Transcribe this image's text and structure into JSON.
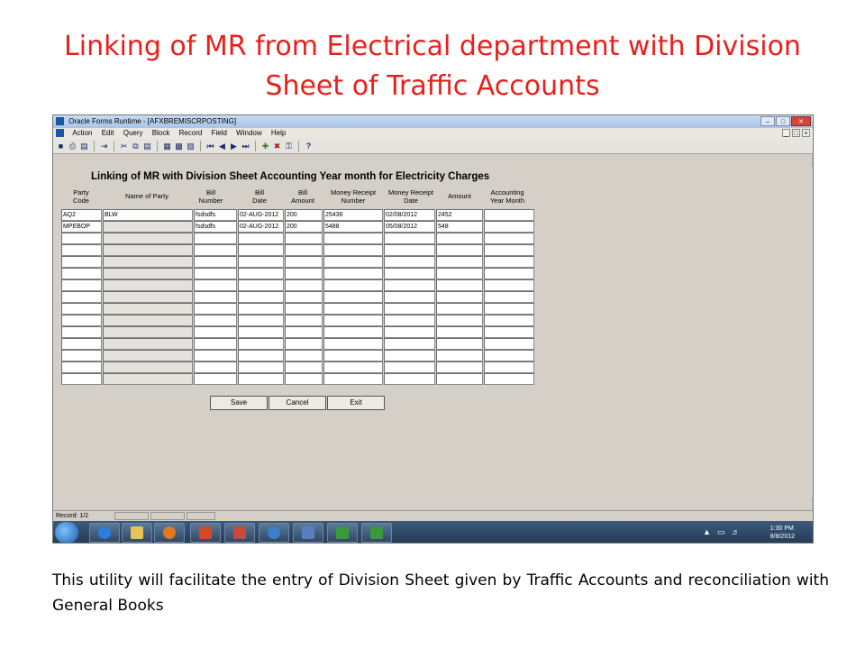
{
  "slide": {
    "title_line1": "Linking of MR from Electrical department with Division",
    "title_line2": "Sheet of Traffic Accounts",
    "caption": "This utility will facilitate the entry of Division Sheet given by Traffic Accounts and reconciliation with General Books"
  },
  "window": {
    "title": "Oracle Forms Runtime - [AFXBREMISCRPOSTING]",
    "menu": [
      "Action",
      "Edit",
      "Query",
      "Block",
      "Record",
      "Field",
      "Window",
      "Help"
    ],
    "toolbar_icons": [
      "save-icon",
      "print-icon",
      "preview-icon",
      "exit-icon",
      "cut-icon",
      "copy-icon",
      "paste-icon",
      "enter-query-icon",
      "execute-query-icon",
      "cancel-query-icon",
      "first-record-icon",
      "prev-record-icon",
      "next-record-icon",
      "last-record-icon",
      "insert-record-icon",
      "delete-record-icon",
      "lock-record-icon",
      "help-icon"
    ]
  },
  "form": {
    "title": "Linking of MR with  Division Sheet Accounting Year month  for Electricity Charges",
    "columns": [
      {
        "key": "party_code",
        "l1": "Party",
        "l2": "Code"
      },
      {
        "key": "party_name",
        "l1": "Name of Party",
        "l2": ""
      },
      {
        "key": "bill_number",
        "l1": "Bill",
        "l2": "Number"
      },
      {
        "key": "bill_date",
        "l1": "Bill",
        "l2": "Date"
      },
      {
        "key": "bill_amount",
        "l1": "Bill",
        "l2": "Amount"
      },
      {
        "key": "mr_number",
        "l1": "Money Receipt",
        "l2": "Number"
      },
      {
        "key": "mr_date",
        "l1": "Money Receipt",
        "l2": "Date"
      },
      {
        "key": "amount",
        "l1": "Amount",
        "l2": ""
      },
      {
        "key": "acct_ym",
        "l1": "Accounting",
        "l2": "Year Month"
      }
    ],
    "rows": [
      [
        "AQ2",
        "BLW",
        "fsdsdfs",
        "02-AUG-2012",
        "200",
        "25436",
        "02/08/2012",
        "2452",
        ""
      ],
      [
        "MPEBOP",
        "",
        "fsdsdfs",
        "02-AUG-2012",
        "200",
        "5488",
        "05/08/2012",
        "548",
        ""
      ]
    ],
    "total_rows": 15,
    "buttons": {
      "save": "Save",
      "cancel": "Cancel",
      "exit": "Exit"
    }
  },
  "status": {
    "record": "Record: 1/2"
  },
  "taskbar": {
    "time": "1:30 PM",
    "date": "8/8/2012"
  }
}
